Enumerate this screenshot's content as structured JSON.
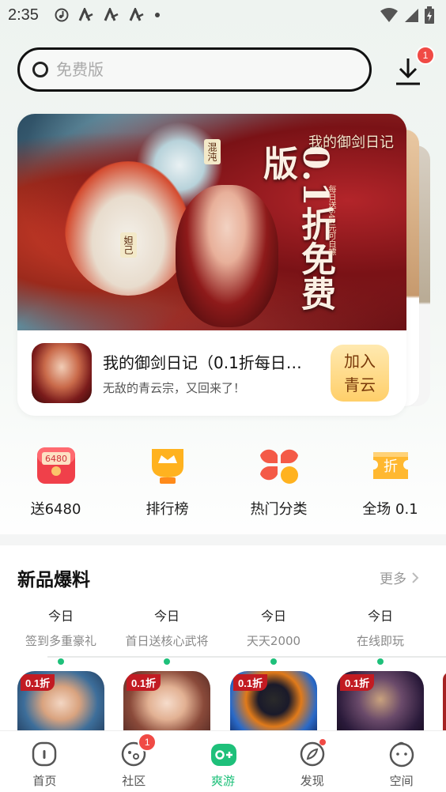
{
  "status_bar": {
    "time": "2:35",
    "left_icons": [
      "music-icon",
      "a-icon",
      "a-icon",
      "a-icon",
      "dot-icon"
    ],
    "right_icons": [
      "wifi-icon",
      "signal-icon",
      "battery-icon"
    ]
  },
  "search": {
    "placeholder": "免费版"
  },
  "download": {
    "badge": "1"
  },
  "banner": {
    "art_title": "我的御剑日记",
    "art_slogan": "0.1折免费版",
    "art_sub": "每日送648元可白嫖",
    "art_label_1": "混沌",
    "art_label_2": "妲己",
    "game_name": "我的御剑日记（0.1折每日…",
    "game_desc": "无敌的青云宗，又回来了！",
    "join_label": "加入青云"
  },
  "quick_nav": [
    {
      "label": "送6480",
      "icon": "red-envelope-icon",
      "icon_text": "6480"
    },
    {
      "label": "排行榜",
      "icon": "trophy-icon"
    },
    {
      "label": "热门分类",
      "icon": "category-icon"
    },
    {
      "label": "全场 0.1",
      "icon": "discount-icon",
      "icon_text": "折"
    }
  ],
  "section": {
    "title": "新品爆料",
    "more": "更多",
    "items": [
      {
        "day": "今日",
        "desc": "签到多重豪礼",
        "tag": "0.1折"
      },
      {
        "day": "今日",
        "desc": "首日送核心武将",
        "tag": "0.1折"
      },
      {
        "day": "今日",
        "desc": "天天2000",
        "tag": "0.1折"
      },
      {
        "day": "今日",
        "desc": "在线即玩",
        "tag": "0.1折"
      }
    ]
  },
  "tabs": [
    {
      "label": "首页",
      "icon": "home-icon"
    },
    {
      "label": "社区",
      "icon": "community-icon",
      "badge": "1"
    },
    {
      "label": "爽游",
      "icon": "gamepad-icon"
    },
    {
      "label": "发现",
      "icon": "compass-icon"
    },
    {
      "label": "空间",
      "icon": "profile-icon"
    }
  ],
  "colors": {
    "accent": "#1ec07a",
    "badge": "#f04a45",
    "join_button": "#ffcf6a"
  }
}
